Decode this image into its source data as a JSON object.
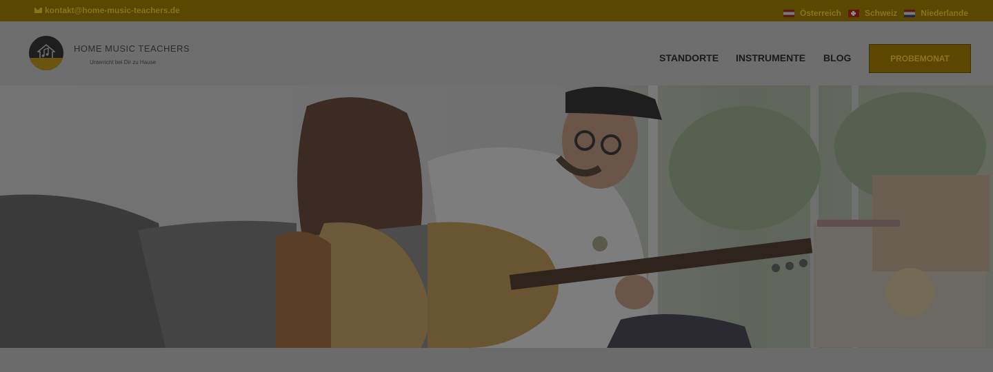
{
  "topbar": {
    "email": "kontakt@home-music-teachers.de",
    "countries": [
      {
        "label": "Österreich",
        "flag": "flag-austria"
      },
      {
        "label": "Schweiz",
        "flag": "flag-switzerland"
      },
      {
        "label": "Niederlande",
        "flag": "flag-netherlands"
      }
    ]
  },
  "brand": {
    "title": "HOME MUSIC TEACHERS",
    "subtitle": "Unterricht bei Dir zu Hause"
  },
  "nav": {
    "items": [
      "STANDORTE",
      "INSTRUMENTE",
      "BLOG"
    ],
    "cta": "PROBEMONAT"
  },
  "colors": {
    "accent": "#5c4600",
    "topbar_bg": "#5a4700",
    "overlay_tint": "#6e6e6e"
  },
  "hero": {
    "image": "guitar-lesson-photo"
  }
}
